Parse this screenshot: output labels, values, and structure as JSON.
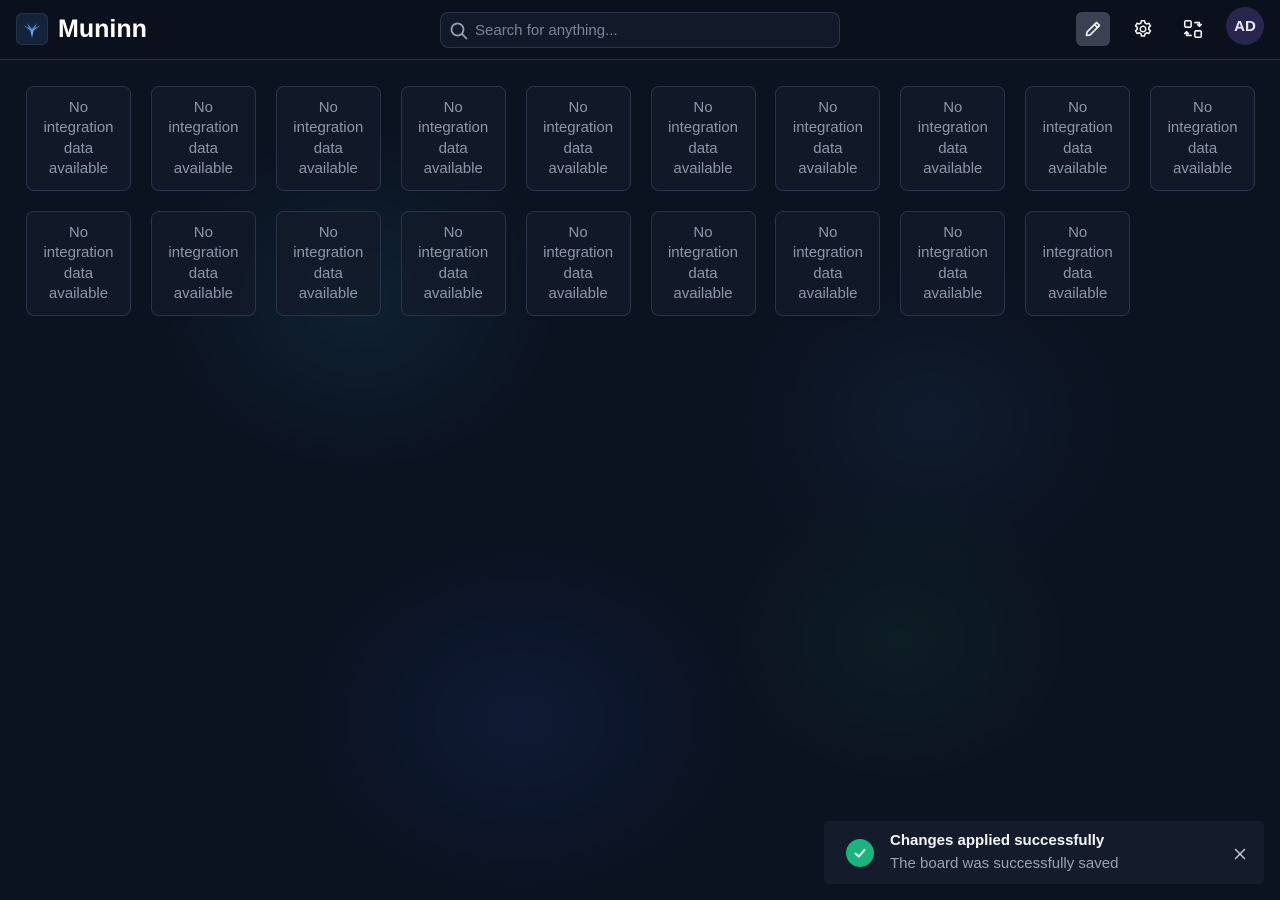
{
  "header": {
    "app_title": "Muninn",
    "logo_icon": "raven-logo-icon",
    "search": {
      "placeholder": "Search for anything...",
      "value": ""
    },
    "actions": [
      {
        "name": "edit-board-button",
        "icon": "pencil-icon",
        "active": true
      },
      {
        "name": "settings-button",
        "icon": "gear-icon",
        "active": false
      },
      {
        "name": "switch-board-button",
        "icon": "swap-layout-icon",
        "active": false
      }
    ],
    "avatar_initials": "AD"
  },
  "tiles": [
    {
      "text": "No integration data available"
    },
    {
      "text": "No integration data available"
    },
    {
      "text": "No integration data available"
    },
    {
      "text": "No integration data available"
    },
    {
      "text": "No integration data available"
    },
    {
      "text": "No integration data available"
    },
    {
      "text": "No integration data available"
    },
    {
      "text": "No integration data available"
    },
    {
      "text": "No integration data available"
    },
    {
      "text": "No integration data available"
    },
    {
      "text": "No integration data available"
    },
    {
      "text": "No integration data available"
    },
    {
      "text": "No integration data available"
    },
    {
      "text": "No integration data available"
    },
    {
      "text": "No integration data available"
    },
    {
      "text": "No integration data available"
    },
    {
      "text": "No integration data available"
    },
    {
      "text": "No integration data available"
    },
    {
      "text": "No integration data available"
    }
  ],
  "toast": {
    "title": "Changes applied successfully",
    "message": "The board was successfully saved",
    "status_color": "#19b57c",
    "icon": "check-circle-icon",
    "close_icon": "close-icon"
  },
  "colors": {
    "background": "#0b1220",
    "tile_border": "#2a3347",
    "tile_text": "#8d96a7",
    "active_button": "#3a4252"
  }
}
